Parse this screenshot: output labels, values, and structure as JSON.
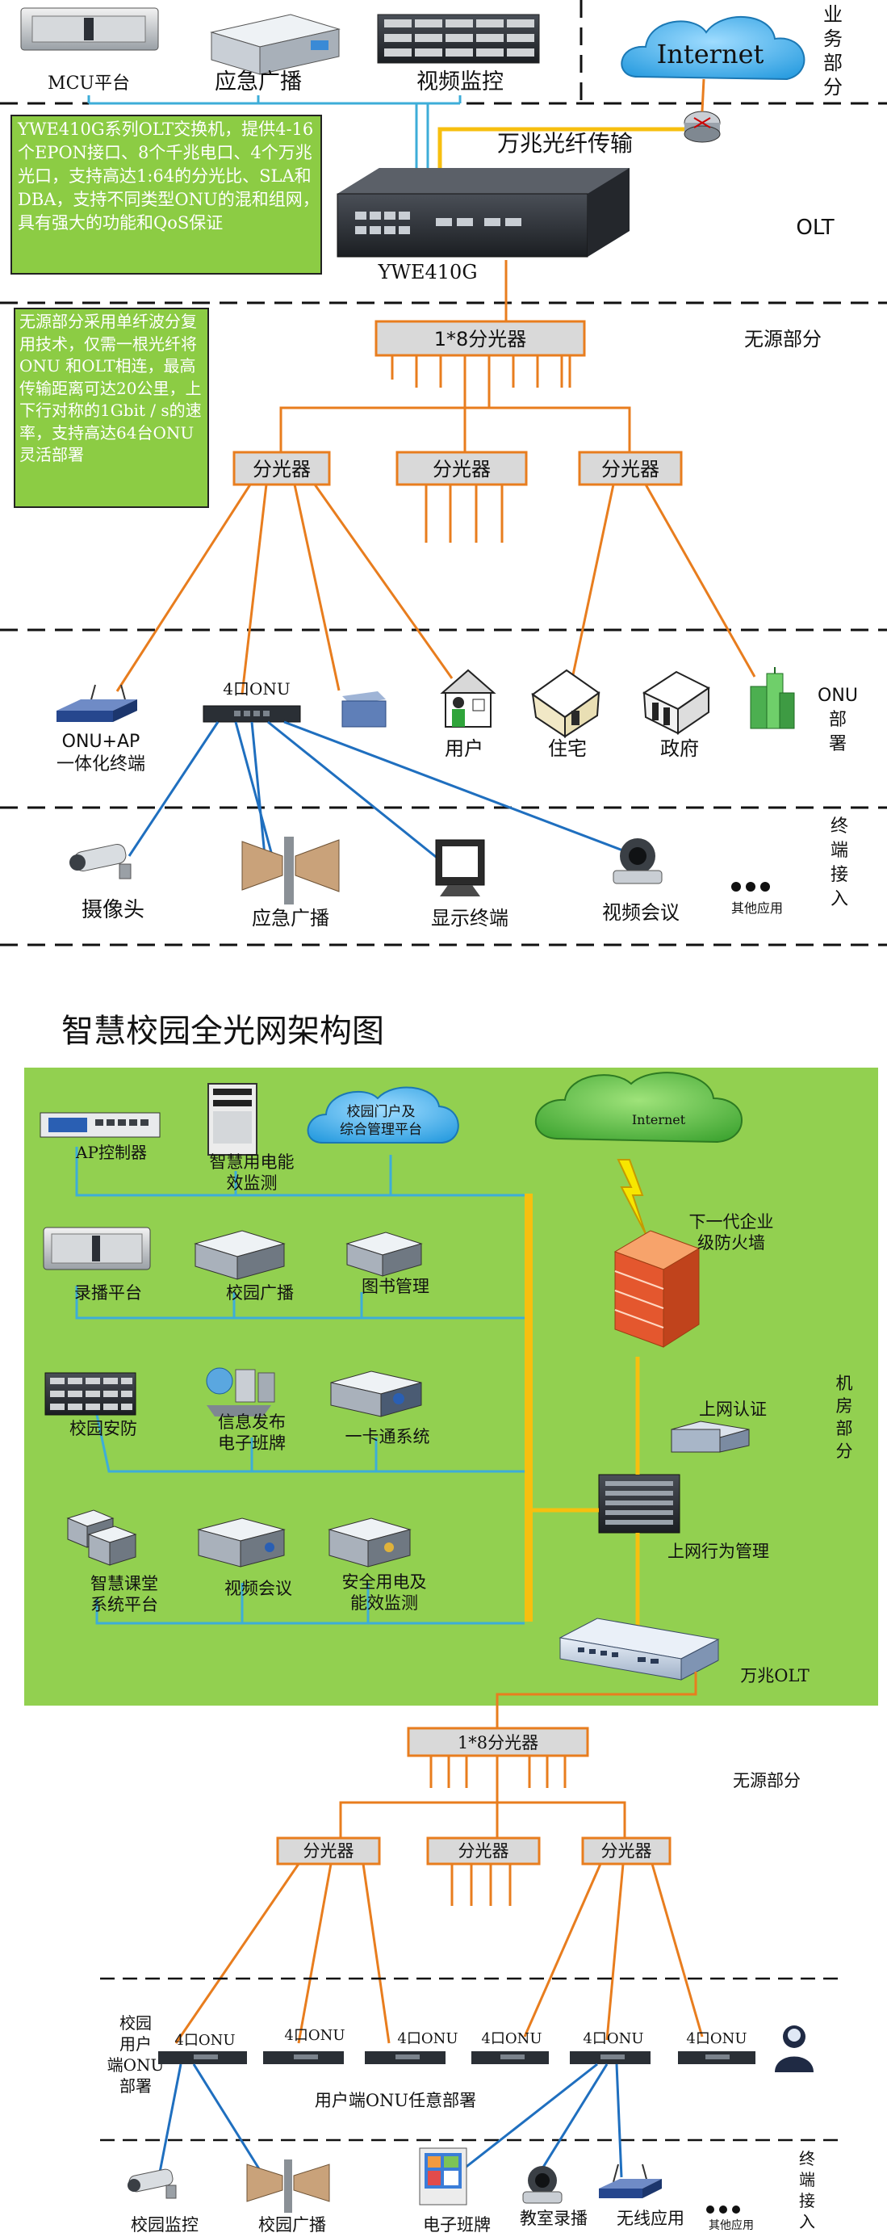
{
  "diagram1": {
    "zone_labels": {
      "business": "业务部分",
      "olt": "OLT",
      "passive": "无源部分",
      "onu": "ONU部署",
      "terminal": "终端接入"
    },
    "mcu_label": "MCU平台",
    "broadcast_label": "应急广播",
    "surveillance_label": "视频监控",
    "internet_label": "Internet",
    "fiber_label": "万兆光纤传输",
    "olt_desc": "YWE410G系列OLT交换机，提供4-16个EPON接口、8个千兆电口、4个万兆光口，支持高达1:64的分光比、SLA和DBA，支持不同类型ONU的混和组网，具有强大的功能和QoS保证",
    "olt_device_label": "YWE410G",
    "passive_desc": "无源部分采用单纤波分复用技术，仅需一根光纤将ONU 和OLT相连，最高传输距离可达20公里，上下行对称的1Gbit / s的速率，支持高达64台ONU 灵活部署",
    "main_splitter": "1*8分光器",
    "splitters": [
      "分光器",
      "分光器",
      "分光器"
    ],
    "onu_port_label": "4口ONU",
    "onu_ap_label": "ONU+AP\n一体化终端",
    "user_label": "用户",
    "residence_label": "住宅",
    "government_label": "政府",
    "camera_label": "摄像头",
    "emergency_broadcast_label": "应急广播",
    "display_label": "显示终端",
    "video_conf_label": "视频会议",
    "other_apps_label": "其他应用"
  },
  "diagram2": {
    "title": "智慧校园全光网架构图",
    "ap_controller": "AP控制器",
    "energy_monitor": "智慧用电能效监测",
    "portal_cloud": "校园门户及综合管理平台",
    "internet_label": "Internet",
    "firewall_label": "下一代企业级防火墙",
    "record_platform": "录播平台",
    "campus_broadcast": "校园广播",
    "library_mgmt": "图书管理",
    "campus_security": "校园安防",
    "info_release": "信息发布\n电子班牌",
    "one_card": "一卡通系统",
    "machine_room": "机房部分",
    "net_auth": "上网认证",
    "net_behavior": "上网行为管理",
    "smart_classroom": "智慧课堂\n系统平台",
    "video_conf": "视频会议",
    "safe_power": "安全用电及\n能效监测",
    "olt_10g": "万兆OLT",
    "main_splitter": "1*8分光器",
    "passive_label": "无源部分",
    "splitters": [
      "分光器",
      "分光器",
      "分光器"
    ],
    "onu_side_label": "校园用户端ONU部署",
    "onu_labels": [
      "4口ONU",
      "4口ONU",
      "4口ONU",
      "4口ONU",
      "4口ONU",
      "4口ONU"
    ],
    "onu_anywhere": "用户端ONU任意部署",
    "terminal_label": "终端接入",
    "campus_monitor": "校园监控",
    "campus_broadcast2": "校园广播",
    "e_classboard": "电子班牌",
    "class_record": "教室录播",
    "wireless": "无线应用",
    "others": "其他应用"
  },
  "colors": {
    "green_bg": "#92d050",
    "green_box": "#8ccc44",
    "orange_line": "#e87d1e",
    "blue_line": "#1f6fbf",
    "yellow_bus": "#f7bf0f",
    "cyan_line": "#3dadd8",
    "splitter_fill": "#d9d9d9",
    "splitter_border": "#e87d1e"
  }
}
